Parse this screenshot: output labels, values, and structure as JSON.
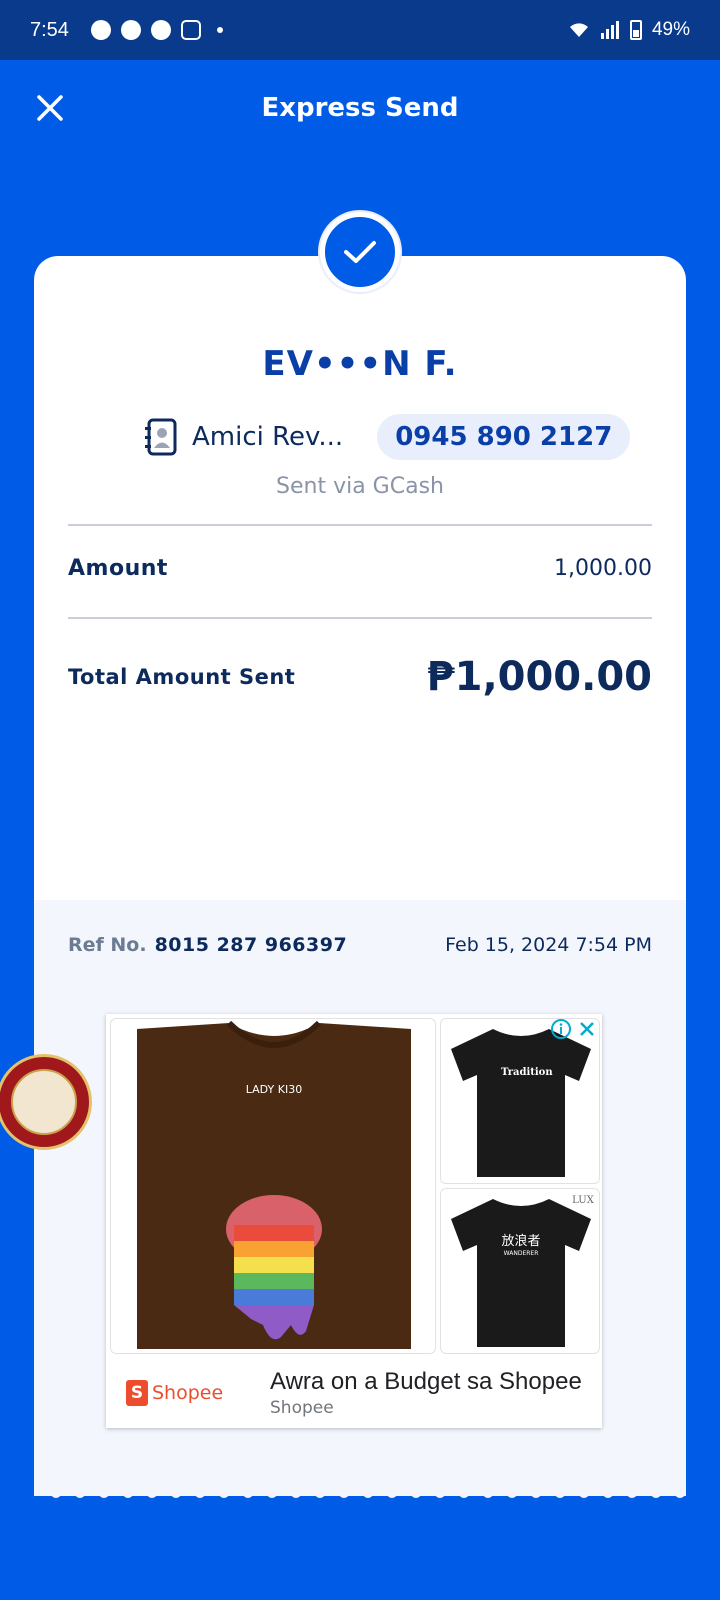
{
  "status_bar": {
    "time": "7:54",
    "battery": "49%",
    "notification_icons": [
      "chat-icon",
      "speedometer-icon",
      "messenger-icon",
      "instagram-icon"
    ]
  },
  "header": {
    "title": "Express Send",
    "close_icon": "close-icon"
  },
  "receipt": {
    "recipient_name": "EV•••N F.",
    "contact_name": "Amici Rev...",
    "phone": "0945 890 2127",
    "sent_via": "Sent via GCash",
    "amount_label": "Amount",
    "amount_value": "1,000.00",
    "total_label": "Total Amount Sent",
    "total_value": "₱1,000.00",
    "ref_label": "Ref No.",
    "ref_no": "8015 287 966397",
    "datetime": "Feb 15, 2024 7:54 PM"
  },
  "ad": {
    "title": "Awra on a Budget sa Shopee",
    "advertiser": "Shopee",
    "logo_text": "Shopee",
    "logo_letter": "S",
    "product1_print": "LADY KI30",
    "product2_print": "Tradition",
    "product3_print": "放浪者",
    "product3_sub": "WANDERER",
    "brand_mark": "LUX"
  },
  "colors": {
    "brand_blue": "#005ce6",
    "status_bar": "#0a3a8c",
    "text_dark": "#0d2a5c",
    "shopee_orange": "#ee4d2d"
  }
}
